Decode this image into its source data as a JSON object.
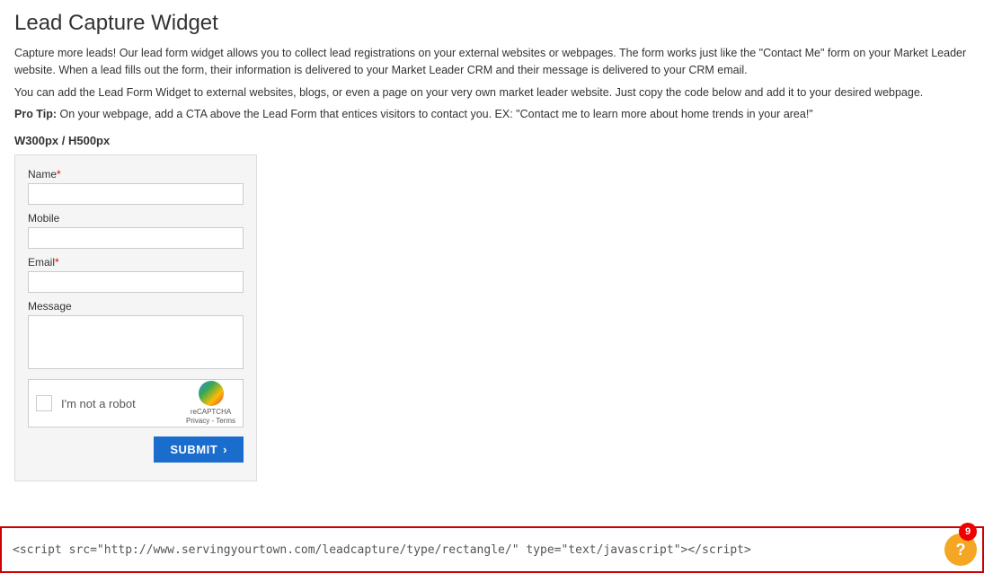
{
  "page": {
    "title": "Lead Capture Widget",
    "description1": "Capture more leads! Our lead form widget allows you to collect lead registrations on your external websites or webpages. The form works just like the \"Contact Me\" form on your Market Leader website. When a lead fills out the form, their information is delivered to your Market Leader CRM and their message is delivered to your CRM email.",
    "description2": "You can add the Lead Form Widget to external websites, blogs, or even a page on your very own market leader website. Just copy the code below and add it to your desired webpage.",
    "pro_tip_label": "Pro Tip:",
    "pro_tip_text": " On your webpage, add a CTA above the Lead Form that entices visitors to contact you. EX: \"Contact me to learn more about home trends in your area!\"",
    "size_label": "W300px / H500px"
  },
  "form": {
    "name_label": "Name",
    "name_required": "*",
    "mobile_label": "Mobile",
    "email_label": "Email",
    "email_required": "*",
    "message_label": "Message",
    "captcha_text": "I'm not a robot",
    "captcha_subtext": "reCAPTCHA",
    "captcha_privacy": "Privacy - Terms",
    "submit_label": "SUBMIT",
    "submit_arrow": "›"
  },
  "code_bar": {
    "code_text": "<script src=\"http://www.servingyourtown.com/leadcapture/type/rectangle/\" type=\"text/javascript\"></script>"
  },
  "notification": {
    "count": "9"
  },
  "help": {
    "icon": "?"
  }
}
